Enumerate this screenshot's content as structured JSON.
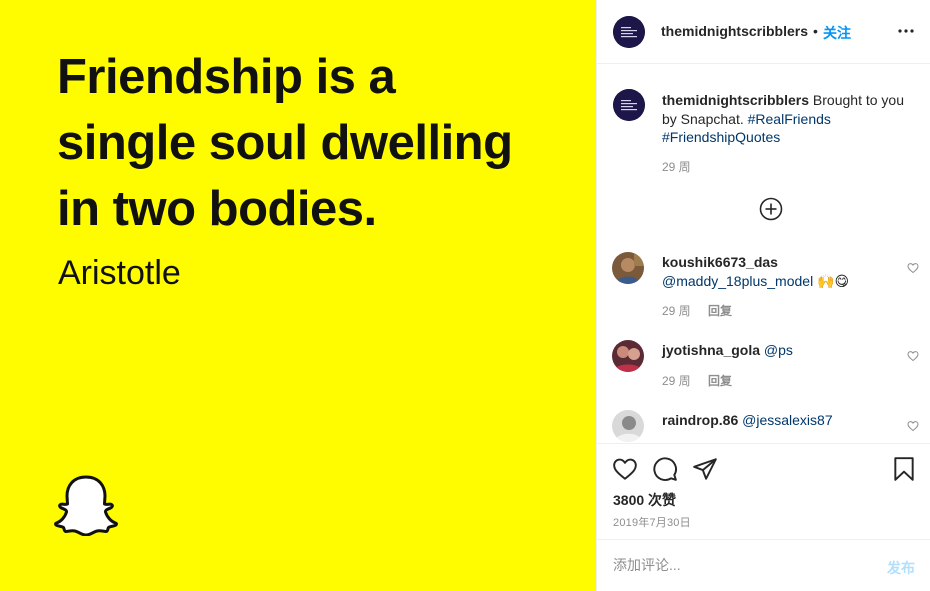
{
  "post_image": {
    "quote_lines": [
      "Friendship is a",
      "single soul dwelling",
      "in two bodies."
    ],
    "author": "Aristotle",
    "background_color": "#fffc00",
    "logo_icon": "snapchat-ghost-icon"
  },
  "header": {
    "username": "themidnightscribblers",
    "separator": "•",
    "follow_label": "关注",
    "more_icon": "more-options-icon"
  },
  "caption": {
    "username": "themidnightscribblers",
    "text": " Brought to you by Snapchat. ",
    "hashtags": [
      "#RealFriends",
      "#FriendshipQuotes"
    ],
    "time": "29 周"
  },
  "load_more_icon": "plus-circle-icon",
  "comments": [
    {
      "username": "koushik6673_das",
      "mention": "@maddy_18plus_model",
      "emoji": "🙌😋",
      "time": "29 周",
      "reply_label": "回复"
    },
    {
      "username": "jyotishna_gola",
      "mention": "@ps",
      "emoji": "",
      "time": "29 周",
      "reply_label": "回复"
    },
    {
      "username": "raindrop.86",
      "mention": "@jessalexis87",
      "emoji": "",
      "time": "",
      "reply_label": ""
    }
  ],
  "actions": {
    "likes": "3800 次赞",
    "date": "2019年7月30日"
  },
  "add_comment": {
    "placeholder": "添加评论...",
    "post_label": "发布"
  },
  "colors": {
    "accent": "#0095f6",
    "hashtag": "#00376b",
    "muted": "#8e8e8e",
    "post_disabled": "#b2dffc"
  }
}
